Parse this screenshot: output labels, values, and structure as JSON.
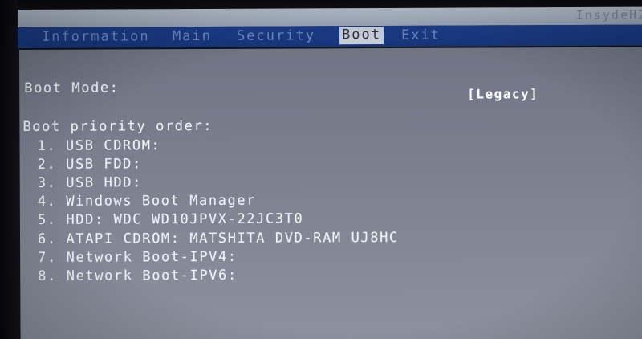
{
  "header": {
    "vendor": "InsydeH2"
  },
  "menu": {
    "items": [
      {
        "label": "Information"
      },
      {
        "label": "Main"
      },
      {
        "label": "Security"
      },
      {
        "label": "Boot"
      },
      {
        "label": "Exit"
      }
    ],
    "active": "Boot"
  },
  "boot": {
    "mode_label": "Boot Mode:",
    "mode_value": "[Legacy]",
    "priority_heading": "Boot priority order:",
    "priority_items": [
      "1. USB CDROM:",
      "2. USB FDD:",
      "3. USB HDD:",
      "4. Windows Boot Manager",
      "5. HDD: WDC WD10JPVX-22JC3T0",
      "6. ATAPI CDROM: MATSHITA DVD-RAM UJ8HC",
      "7. Network Boot-IPV4:",
      "8. Network Boot-IPV6:"
    ]
  },
  "colors": {
    "menu_bar": "#1b3d8a",
    "menu_inactive_text": "#6f86bd",
    "menu_active_bg": "#c7cdd8",
    "content_bg": "#7f8593",
    "content_text": "#f1f2f6"
  }
}
